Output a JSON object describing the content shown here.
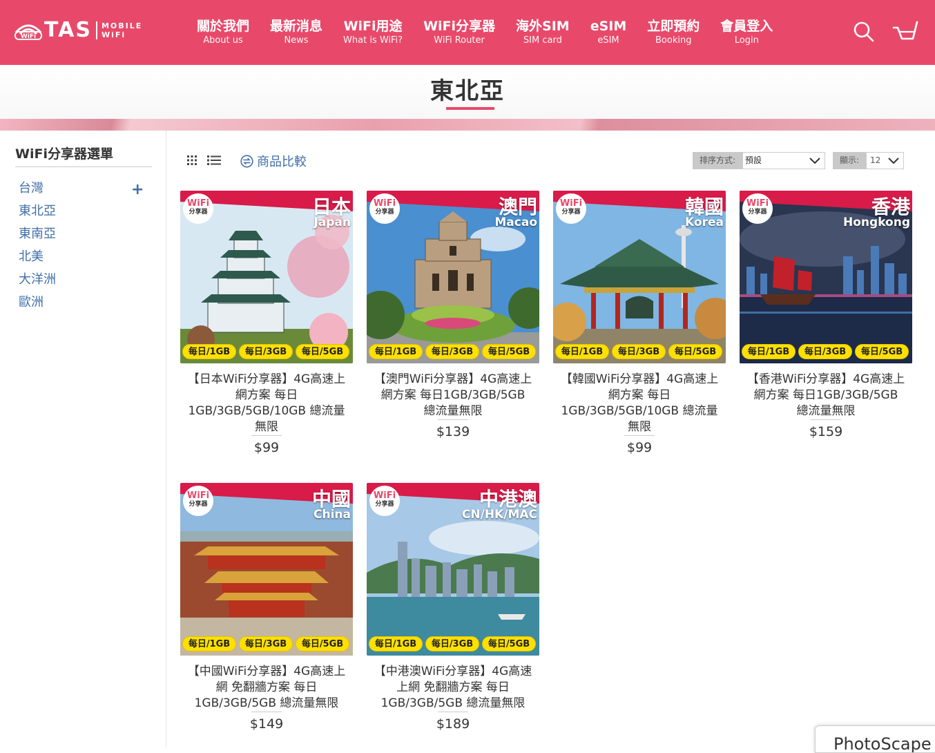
{
  "brand": {
    "name": "TAS",
    "sub1": "MOBILE",
    "sub2": "WiFi",
    "logo_badge": "WiFi"
  },
  "nav": [
    {
      "zh": "關於我們",
      "en": "About us"
    },
    {
      "zh": "最新消息",
      "en": "News"
    },
    {
      "zh": "WiFi用途",
      "en": "What is WiFi?"
    },
    {
      "zh": "WiFi分享器",
      "en": "WiFi Router"
    },
    {
      "zh": "海外SIM",
      "en": "SIM card"
    },
    {
      "zh": "eSIM",
      "en": "eSIM"
    },
    {
      "zh": "立即預約",
      "en": "Booking"
    },
    {
      "zh": "會員登入",
      "en": "Login"
    }
  ],
  "page_title": "東北亞",
  "sidebar": {
    "title": "WiFi分享器選單",
    "items": [
      "台灣",
      "東北亞",
      "東南亞",
      "北美",
      "大洋洲",
      "歐洲"
    ],
    "plus": "+"
  },
  "toolbar": {
    "compare": "商品比較",
    "sort_label": "排序方式:",
    "sort_value": "預設",
    "show_label": "顯示:",
    "show_value": "12"
  },
  "pills": [
    "每日/1GB",
    "每日/3GB",
    "每日/5GB"
  ],
  "badge": {
    "top": "WiFi",
    "bottom": "分享器"
  },
  "products": [
    {
      "img_zh": "日本",
      "img_en": "Japan",
      "name": "【日本WiFi分享器】4G高速上網方案 每日1GB/3GB/5GB/10GB 總流量無限",
      "price": "$99"
    },
    {
      "img_zh": "澳門",
      "img_en": "Macao",
      "name": "【澳門WiFi分享器】4G高速上網方案 每日1GB/3GB/5GB 總流量無限",
      "price": "$139"
    },
    {
      "img_zh": "韓國",
      "img_en": "Korea",
      "name": "【韓國WiFi分享器】4G高速上網方案 每日1GB/3GB/5GB/10GB 總流量無限",
      "price": "$99"
    },
    {
      "img_zh": "香港",
      "img_en": "Hongkong",
      "name": "【香港WiFi分享器】4G高速上網方案 每日1GB/3GB/5GB 總流量無限",
      "price": "$159"
    },
    {
      "img_zh": "中國",
      "img_en": "China",
      "name": "【中國WiFi分享器】4G高速上網 免翻牆方案 每日1GB/3GB/5GB 總流量無限",
      "price": "$149"
    },
    {
      "img_zh": "中港澳",
      "img_en": "CN/HK/MAC",
      "name": "【中港澳WiFi分享器】4G高速上網 免翻牆方案 每日1GB/3GB/5GB 總流量無限",
      "price": "$189"
    }
  ],
  "floating_window": "PhotoScape"
}
